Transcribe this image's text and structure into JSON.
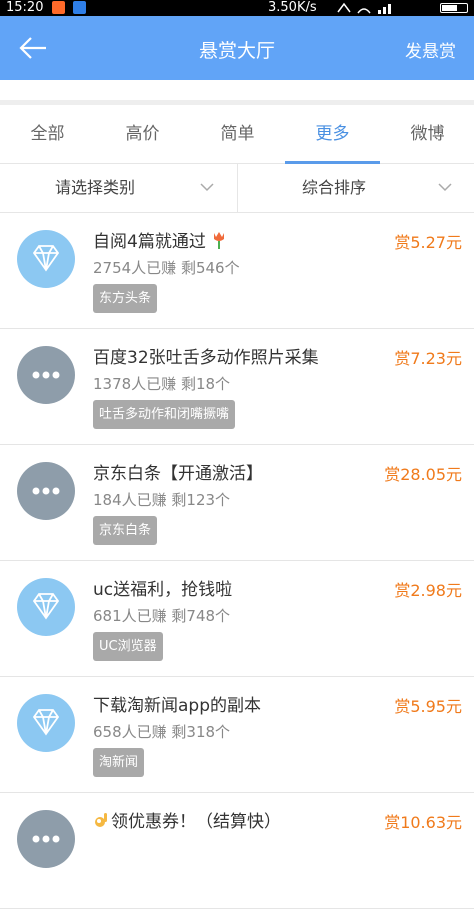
{
  "status_bar": {
    "time": "15:20",
    "speed": "3.50K/s"
  },
  "header": {
    "title": "悬赏大厅",
    "action": "发悬赏"
  },
  "tabs": [
    {
      "label": "全部",
      "active": false
    },
    {
      "label": "高价",
      "active": false
    },
    {
      "label": "简单",
      "active": false
    },
    {
      "label": "更多",
      "active": true
    },
    {
      "label": "微博",
      "active": false
    }
  ],
  "filters": {
    "category": "请选择类别",
    "sort": "综合排序"
  },
  "tasks": [
    {
      "icon": "diamond",
      "title": "自阅4篇就通过",
      "stats": "2754人已赚  剩546个",
      "tag": "东方头条",
      "reward": "赏5.27元"
    },
    {
      "icon": "more",
      "title": "百度32张吐舌多动作照片采集",
      "stats": "1378人已赚  剩18个",
      "tag": "吐舌多动作和闭嘴撅嘴",
      "reward": "赏7.23元"
    },
    {
      "icon": "more",
      "title": "京东白条【开通激活】",
      "stats": "184人已赚  剩123个",
      "tag": "京东白条",
      "reward": "赏28.05元"
    },
    {
      "icon": "diamond",
      "title": "uc送福利，抢钱啦",
      "stats": "681人已赚  剩748个",
      "tag": "UC浏览器",
      "reward": "赏2.98元"
    },
    {
      "icon": "diamond",
      "title": "下载淘新闻app的副本",
      "stats": "658人已赚  剩318个",
      "tag": "淘新闻",
      "reward": "赏5.95元"
    },
    {
      "icon": "more",
      "title": "领优惠券！（结算快）",
      "stats": "",
      "tag": "",
      "reward": "赏10.63元"
    }
  ],
  "colors": {
    "header": "#61a4f7",
    "accent": "#4a90e2",
    "reward": "#f07a1b",
    "tag_bg": "#a9a9a9"
  }
}
